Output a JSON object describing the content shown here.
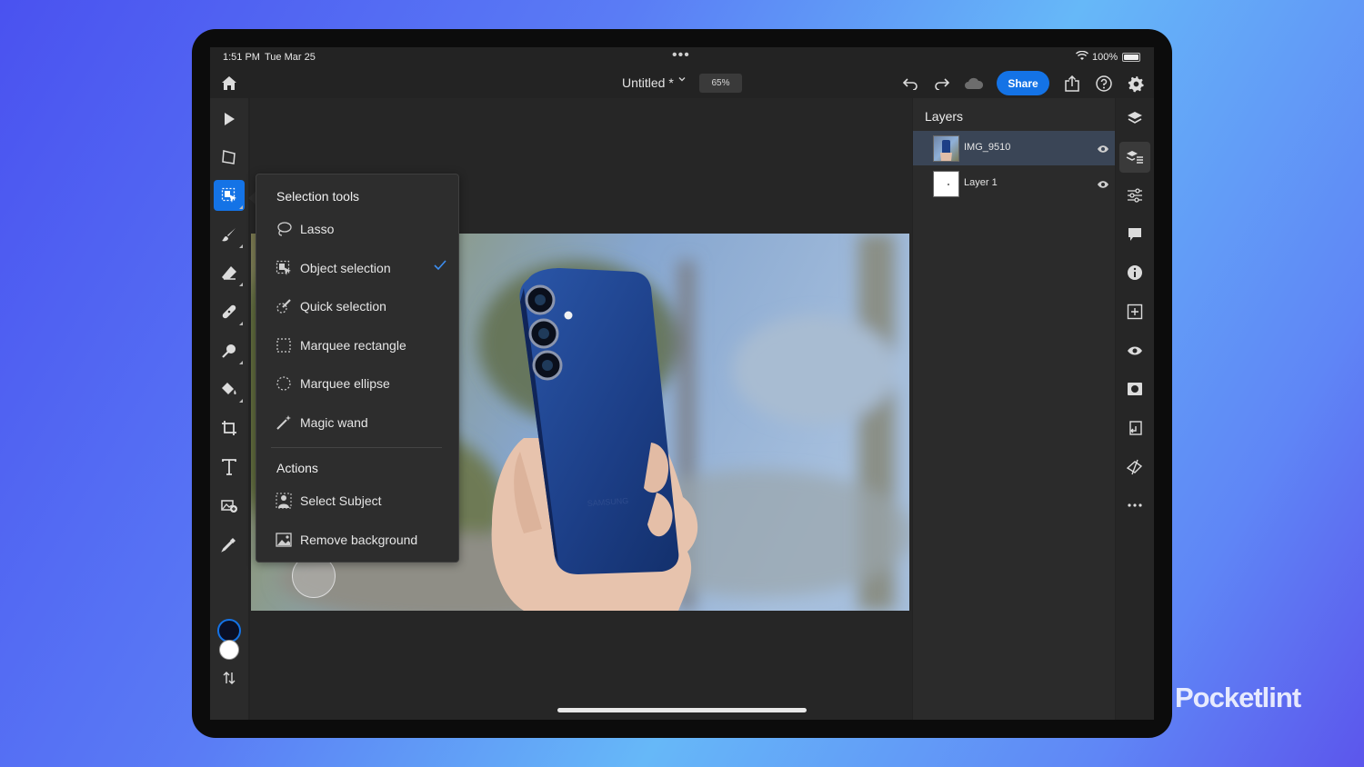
{
  "status_bar": {
    "time": "1:51 PM",
    "date": "Tue Mar 25",
    "battery": "100%"
  },
  "top_bar": {
    "doc_title": "Untitled *",
    "zoom": "65%",
    "share_label": "Share"
  },
  "selection_menu": {
    "heading": "Selection tools",
    "items": [
      {
        "label": "Lasso",
        "icon": "lasso-icon",
        "checked": false
      },
      {
        "label": "Object selection",
        "icon": "object-selection-icon",
        "checked": true
      },
      {
        "label": "Quick selection",
        "icon": "quick-selection-icon",
        "checked": false
      },
      {
        "label": "Marquee rectangle",
        "icon": "marquee-rectangle-icon",
        "checked": false
      },
      {
        "label": "Marquee ellipse",
        "icon": "marquee-ellipse-icon",
        "checked": false
      },
      {
        "label": "Magic wand",
        "icon": "magic-wand-icon",
        "checked": false
      }
    ],
    "actions_heading": "Actions",
    "actions": [
      {
        "label": "Select Subject",
        "icon": "select-subject-icon"
      },
      {
        "label": "Remove background",
        "icon": "remove-background-icon"
      }
    ]
  },
  "layers_panel": {
    "title": "Layers",
    "layers": [
      {
        "name": "IMG_9510",
        "selected": true
      },
      {
        "name": "Layer 1",
        "selected": false
      }
    ]
  },
  "canvas": {
    "phone_brand_text": "SAMSUNG"
  },
  "colors": {
    "accent": "#1473e6",
    "foreground_swatch": "#0a0f25",
    "background_swatch": "#ffffff",
    "phone_blue": "#1d3f86"
  },
  "watermark": "Pocketlint"
}
